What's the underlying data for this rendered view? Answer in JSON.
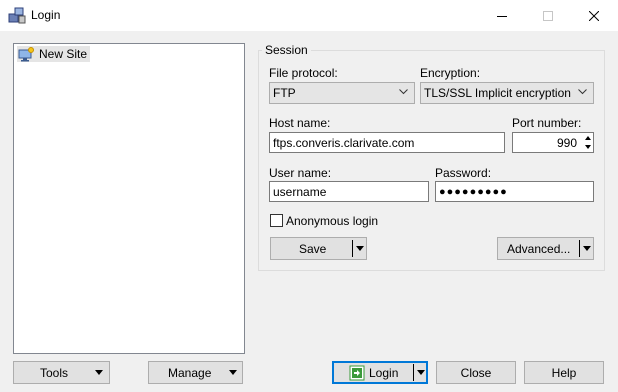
{
  "window": {
    "title": "Login"
  },
  "sites": [
    {
      "label": "New Site"
    }
  ],
  "session": {
    "group_title": "Session",
    "file_protocol_label": "File protocol:",
    "file_protocol_value": "FTP",
    "encryption_label": "Encryption:",
    "encryption_value": "TLS/SSL Implicit encryption",
    "host_name_label": "Host name:",
    "host_name_value": "ftps.converis.clarivate.com",
    "port_number_label": "Port number:",
    "port_number_value": "990",
    "user_name_label": "User name:",
    "user_name_value": "username",
    "password_label": "Password:",
    "password_value": "●●●●●●●●●",
    "anonymous_login_label": "Anonymous login",
    "anonymous_login_checked": false,
    "save_label": "Save",
    "advanced_label": "Advanced..."
  },
  "bottom_buttons": {
    "tools_label": "Tools",
    "manage_label": "Manage",
    "login_label": "Login",
    "close_label": "Close",
    "help_label": "Help"
  },
  "colors": {
    "accent": "#0078d7",
    "login_icon": "#3a9a3a"
  }
}
